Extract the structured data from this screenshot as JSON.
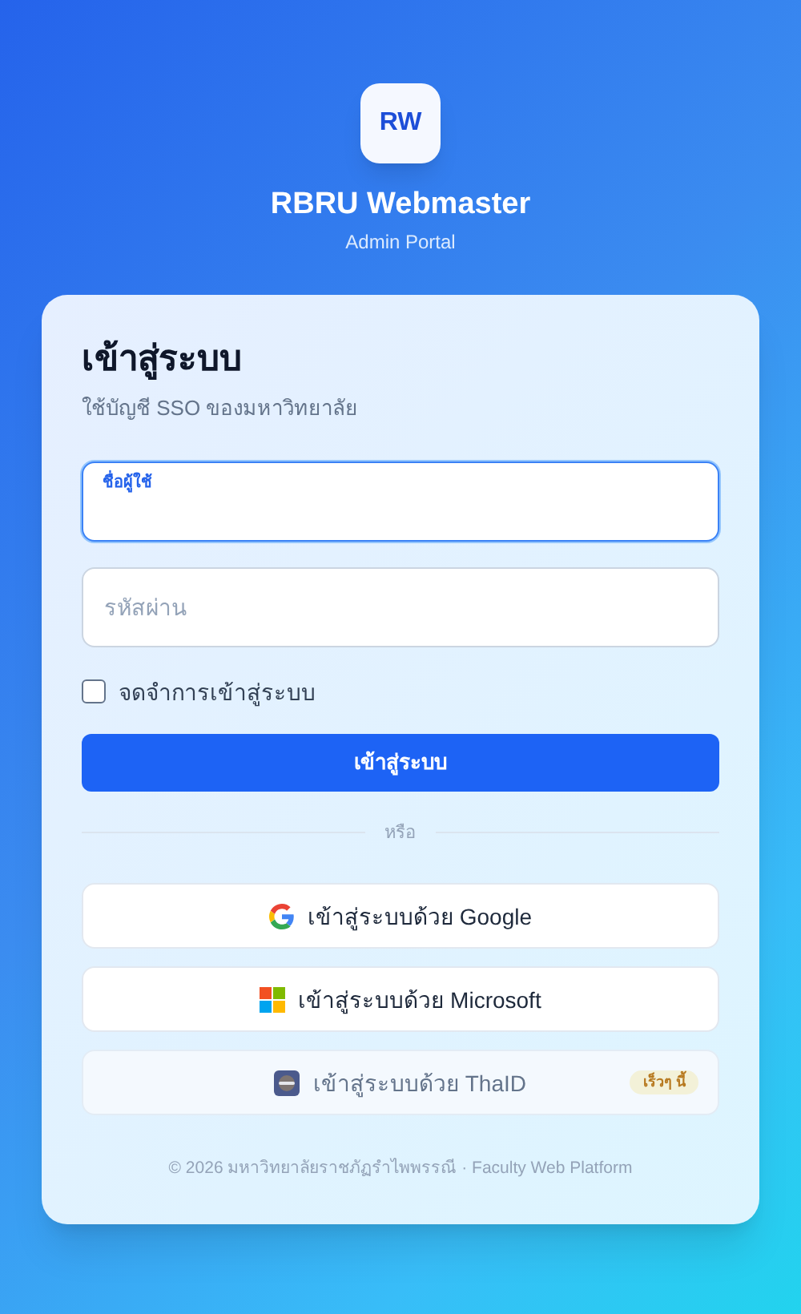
{
  "brand": {
    "logo": "RW",
    "title": "RBRU Webmaster",
    "subtitle": "Admin Portal"
  },
  "card": {
    "title": "เข้าสู่ระบบ",
    "subtitle": "ใช้บัญชี SSO ของมหาวิทยาลัย"
  },
  "fields": [
    {
      "label": "ชื่อผู้ใช้",
      "focused": true
    },
    {
      "placeholder": "รหัสผ่าน",
      "focused": false
    }
  ],
  "remember": {
    "label": "จดจำการเข้าสู่ระบบ",
    "checked": false
  },
  "submit": "เข้าสู่ระบบ",
  "divider": "หรือ",
  "providers": [
    {
      "kind": "google",
      "label": "เข้าสู่ระบบด้วย Google",
      "disabled": false
    },
    {
      "kind": "microsoft",
      "label": "เข้าสู่ระบบด้วย Microsoft",
      "disabled": false
    },
    {
      "kind": "thaid",
      "label": "เข้าสู่ระบบด้วย ThaID",
      "disabled": true,
      "badge": "เร็วๆ นี้"
    }
  ],
  "footer": "© 2026 มหาวิทยาลัยราชภัฏรำไพพรรณี · Faculty Web Platform"
}
